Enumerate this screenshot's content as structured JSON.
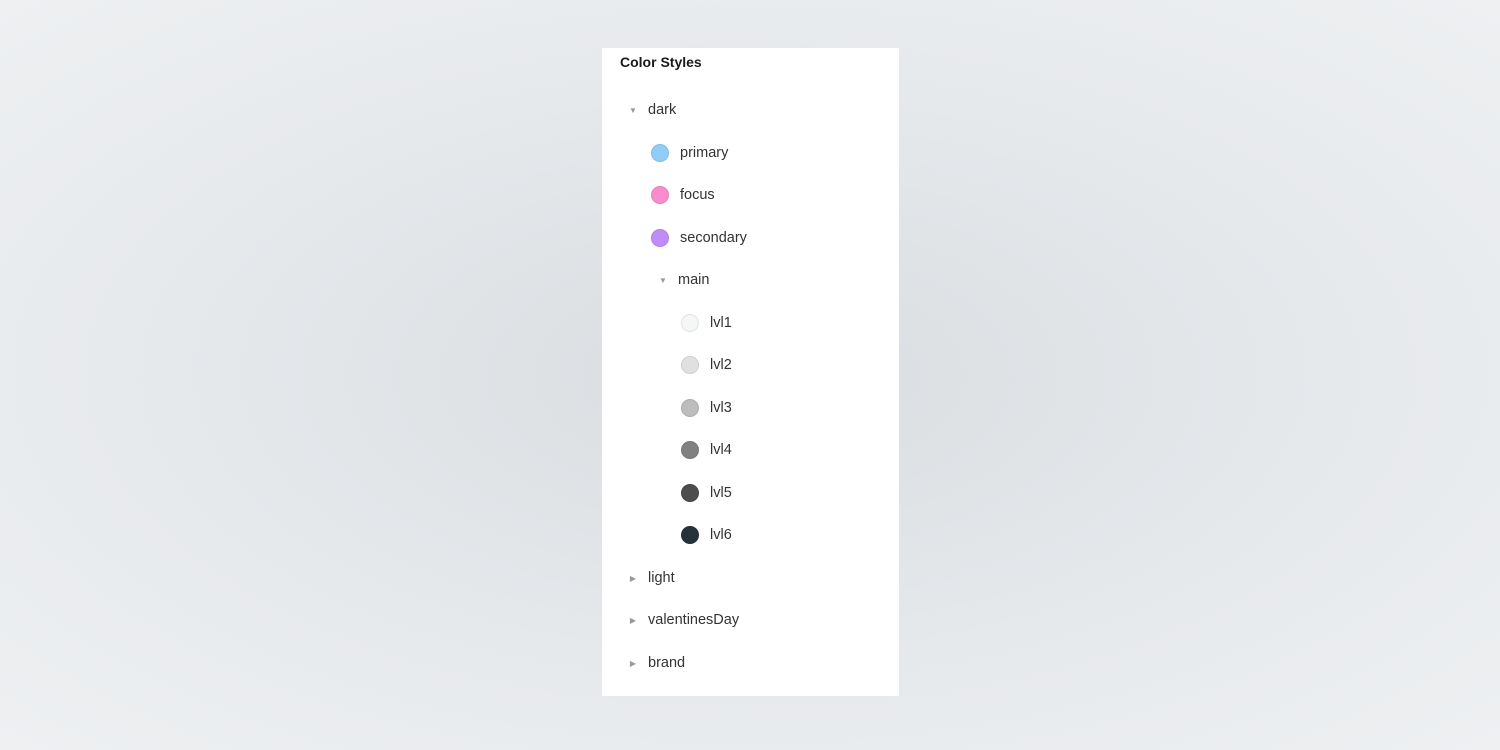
{
  "panel": {
    "title": "Color Styles",
    "groups": [
      {
        "label": "dark",
        "expanded": true,
        "items": [
          {
            "label": "primary",
            "color": "#90cdf9"
          },
          {
            "label": "focus",
            "color": "#f98ccb"
          },
          {
            "label": "secondary",
            "color": "#c08cf7"
          }
        ],
        "subgroup": {
          "label": "main",
          "expanded": true,
          "items": [
            {
              "label": "lvl1",
              "color": "#f5f6f7"
            },
            {
              "label": "lvl2",
              "color": "#e0e0e0"
            },
            {
              "label": "lvl3",
              "color": "#bdbdbd"
            },
            {
              "label": "lvl4",
              "color": "#808080"
            },
            {
              "label": "lvl5",
              "color": "#4d4d4d"
            },
            {
              "label": "lvl6",
              "color": "#26323a"
            }
          ]
        }
      },
      {
        "label": "light",
        "expanded": false
      },
      {
        "label": "valentinesDay",
        "expanded": false
      },
      {
        "label": "brand",
        "expanded": false
      }
    ]
  },
  "icons": {
    "expanded": "▼",
    "collapsed": "▶"
  }
}
